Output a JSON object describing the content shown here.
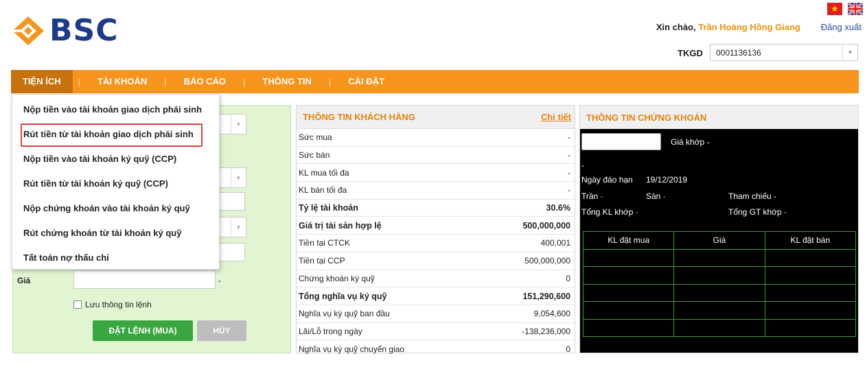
{
  "header": {
    "brand": "BSC",
    "greeting_prefix": "Xin chào, ",
    "user_name": "Trần Hoàng Hồng Giang",
    "logout": "Đăng xuất",
    "tkgd_label": "TKGD",
    "tkgd_value": "0001136136",
    "flags": [
      "vietnam-flag",
      "uk-flag"
    ]
  },
  "nav": {
    "items": [
      {
        "label": "TIỆN ÍCH"
      },
      {
        "label": "TÀI KHOẢN"
      },
      {
        "label": "BÁO CÁO"
      },
      {
        "label": "THÔNG TIN"
      },
      {
        "label": "CÀI ĐẶT"
      }
    ],
    "separator": "|"
  },
  "menu": {
    "items": [
      "Nộp tiền vào tài khoản giao dịch phái sinh",
      "Rút tiền từ tài khoản giao dịch phái sinh",
      "Nộp tiền vào tài khoản ký quỹ (CCP)",
      "Rút tiền từ tài khoản ký quỹ (CCP)",
      "Nộp chứng khoán vào tài khoản ký quỹ",
      "Rút chứng khoán từ tài khoản ký quỹ",
      "Tất toán nợ thấu chi"
    ],
    "highlighted_index": 1
  },
  "order": {
    "price_label": "Giá",
    "price_suffix": "-",
    "save_label": "Lưu thông tin lệnh",
    "place_button": "ĐẶT LỆNH (MUA)",
    "cancel_button": "HỦY"
  },
  "customer": {
    "title": "THÔNG TIN KHÁCH HÀNG",
    "detail": "Chi tiết",
    "rows": [
      {
        "label": "Sức mua",
        "value": "-",
        "bold": false
      },
      {
        "label": "Sức bán",
        "value": "-",
        "bold": false
      },
      {
        "label": "KL mua tối đa",
        "value": "-",
        "bold": false
      },
      {
        "label": "KL bán tối đa",
        "value": "-",
        "bold": false
      },
      {
        "label": "Tỷ lệ tài khoản",
        "value": "30.6%",
        "bold": true
      },
      {
        "label": "Giá trị tài sản hợp lệ",
        "value": "500,000,000",
        "bold": true
      },
      {
        "label": "Tiền tại CTCK",
        "value": "400,001",
        "bold": false
      },
      {
        "label": "Tiền tại CCP",
        "value": "500,000,000",
        "bold": false
      },
      {
        "label": "Chứng khoán ký quỹ",
        "value": "0",
        "bold": false
      },
      {
        "label": "Tổng nghĩa vụ ký quỹ",
        "value": "151,290,600",
        "bold": true
      },
      {
        "label": "Nghĩa vụ ký quỹ ban đầu",
        "value": "9,054,600",
        "bold": false
      },
      {
        "label": "Lãi/Lỗ trong ngày",
        "value": "-138,236,000",
        "bold": false
      },
      {
        "label": "Nghĩa vụ ký quỹ chuyển giao",
        "value": "0",
        "bold": false
      }
    ]
  },
  "securities": {
    "title": "THÔNG TIN CHỨNG KHOÁN",
    "match_price_label": "Giá khớp",
    "match_price_value": "-",
    "dash_line": "-",
    "maturity_label": "Ngày đáo hạn",
    "maturity_value": "19/12/2019",
    "ceiling_label": "Trần",
    "ceiling_value": "-",
    "floor_label": "Sàn",
    "floor_value": "-",
    "reference_label": "Tham chiếu",
    "reference_value": "-",
    "total_vol_label": "Tổng KL khớp",
    "total_vol_value": "-",
    "total_val_label": "Tổng GT khớp",
    "total_val_value": "-",
    "table_headers": [
      "KL đặt mua",
      "Giá",
      "KL đặt bán"
    ],
    "table_rows": 5
  },
  "colors": {
    "brand_orange": "#f7941d",
    "brand_blue": "#1c3b8c",
    "panel_green": "#e1f5d2",
    "highlight_red": "#e23b3b"
  }
}
